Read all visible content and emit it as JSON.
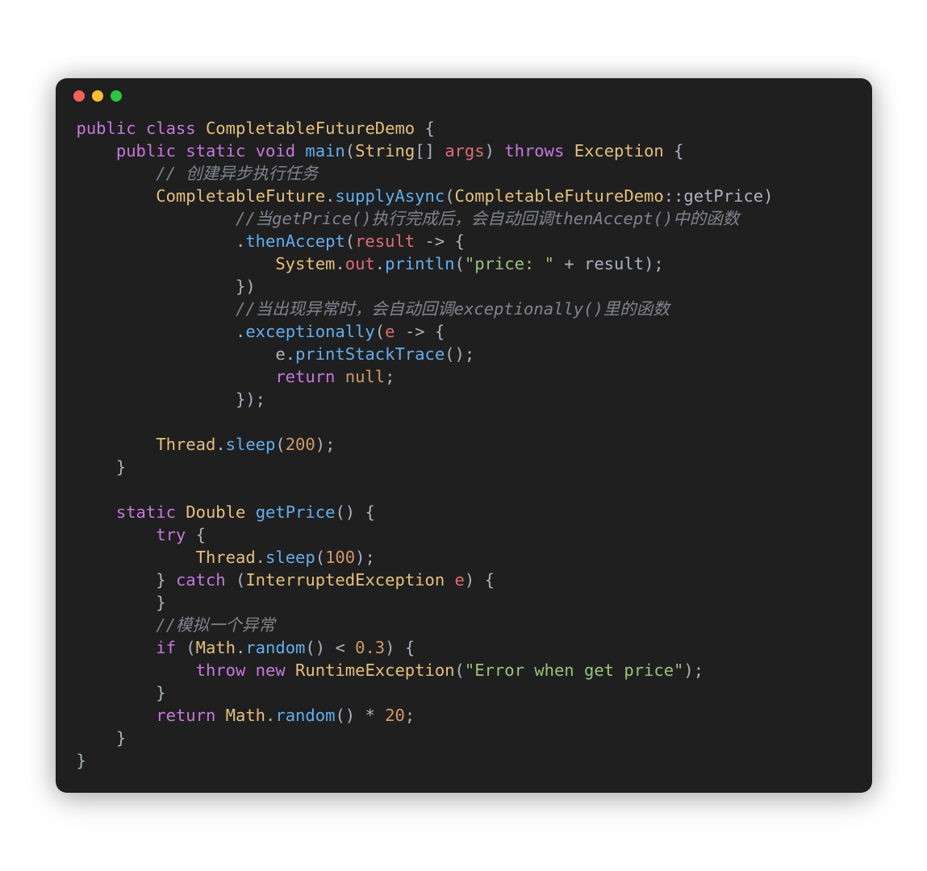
{
  "window": {
    "dots": [
      "red",
      "yellow",
      "green"
    ]
  },
  "code": {
    "className": "CompletableFutureDemo",
    "mainSig": {
      "kw_public": "public",
      "kw_static": "static",
      "kw_void": "void",
      "fn": "main",
      "ty_String": "String",
      "args": "args",
      "kw_throws": "throws",
      "ty_Exception": "Exception"
    },
    "cm_create": "// 创建异步执行任务",
    "l_supply": {
      "ty": "CompletableFuture",
      "fn": "supplyAsync",
      "dc": "CompletableFutureDemo",
      "getPrice": "getPrice"
    },
    "cm_thenAccept": "//当getPrice()执行完成后，会自动回调thenAccept()中的函数",
    "thenAccept": "thenAccept",
    "result": "result",
    "print": {
      "ty": "System",
      "out": "out",
      "fn": "println",
      "str": "\"price: \""
    },
    "cm_exceptionally": "//当出现异常时，会自动回调exceptionally()里的函数",
    "exceptionally": "exceptionally",
    "e": "e",
    "printStack": "printStackTrace",
    "kw_return": "return",
    "null": "null",
    "thread": "Thread",
    "sleep": "sleep",
    "n200": "200",
    "getPriceSig": {
      "kw_static": "static",
      "ty_Double": "Double",
      "fn": "getPrice"
    },
    "kw_try": "try",
    "kw_catch": "catch",
    "ty_IE": "InterruptedException",
    "n100": "100",
    "cm_mock": "//模拟一个异常",
    "kw_if": "if",
    "ty_Math": "Math",
    "fn_random": "random",
    "n03": "0.3",
    "kw_throw": "throw",
    "kw_new": "new",
    "ty_RE": "RuntimeException",
    "str_err": "\"Error when get price\"",
    "n20": "20",
    "punct": {
      "obr": "{",
      "cbr": "}",
      "op": "(",
      "cp": ")",
      "osq": "[",
      "csq": "]",
      "semi": ";",
      "comma": ",",
      "dot": ".",
      "cc": "::",
      "arrow": "->",
      "lt": "<",
      "star": "*",
      "plus": "+",
      "sp": " "
    },
    "kw": {
      "public": "public",
      "class": "class",
      "static": "static",
      "void": "void",
      "throws": "throws",
      "return": "return",
      "try": "try",
      "catch": "catch",
      "if": "if",
      "throw": "throw",
      "new": "new"
    }
  }
}
